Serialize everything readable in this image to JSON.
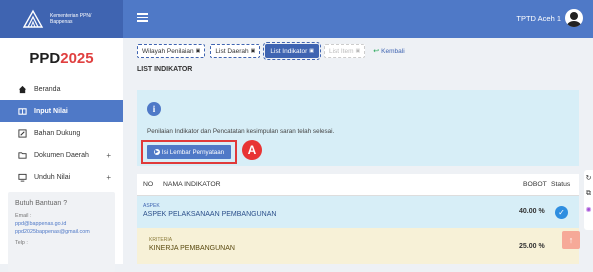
{
  "brand": {
    "line1": "Kementerian PPN/",
    "line2": "Bappenas"
  },
  "user": {
    "name": "TPTD Aceh 1"
  },
  "sidebar": {
    "title_main": "PPD",
    "title_year": "2025",
    "items": [
      {
        "label": "Beranda",
        "icon": "home-icon"
      },
      {
        "label": "Input Nilai",
        "icon": "book-icon",
        "active": true
      },
      {
        "label": "Bahan Dukung",
        "icon": "edit-icon"
      },
      {
        "label": "Dokumen Daerah",
        "icon": "folder-icon",
        "expand": "+"
      },
      {
        "label": "Unduh Nilai",
        "icon": "monitor-icon",
        "expand": "+"
      }
    ],
    "help": {
      "title": "Butuh Bantuan ?",
      "email_label": "Email :",
      "email1": "ppd@bappenas.go.id",
      "email2": "ppd2025bappenas@gmail.com",
      "phone_label": "Telp :"
    }
  },
  "tabs": [
    {
      "label": "Wilayah Penilaian",
      "badge": "▣"
    },
    {
      "label": "List Daerah",
      "badge": "▣"
    },
    {
      "label": "List Indikator",
      "badge": "▣",
      "active": true
    },
    {
      "label": "List Item",
      "badge": "▣",
      "disabled": true
    }
  ],
  "kembali": "Kembali",
  "section_title": "LIST INDIKATOR",
  "panel": {
    "message": "Penilaian Indikator dan Pencatatan kesimpulan saran telah selesai.",
    "button": "Isi Lembar Pernyataan",
    "marker": "A"
  },
  "table": {
    "headers": {
      "no": "NO",
      "nama": "NAMA INDIKATOR",
      "bobot": "BOBOT",
      "status": "Status"
    },
    "aspek": {
      "small": "ASPEK",
      "name": "ASPEK PELAKSANAAN PEMBANGUNAN",
      "bobot": "40.00 %"
    },
    "kriteria": {
      "small": "KRITERIA",
      "name": "KINERJA PEMBANGUNAN",
      "bobot": "25.00 %"
    }
  },
  "colors": {
    "primary": "#4f79c7",
    "brand_dark": "#3f64b1",
    "accent_red": "#e03a3a",
    "info_bg": "#d7eef7",
    "kriteria_bg": "#f7f1d7"
  }
}
